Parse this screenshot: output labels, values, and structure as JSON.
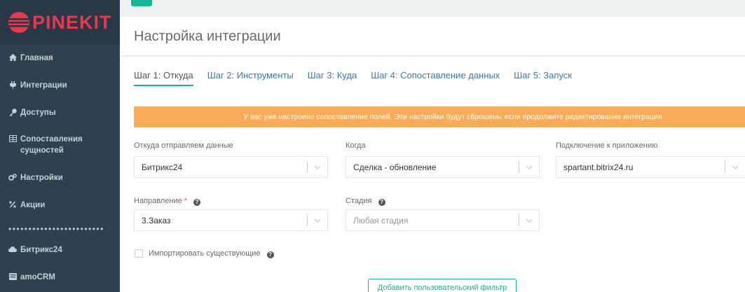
{
  "brand": {
    "name": "PINEKIT",
    "color": "#e8374e"
  },
  "sidebar": {
    "items": [
      {
        "label": "Главная",
        "icon": "home-icon"
      },
      {
        "label": "Интеграции",
        "icon": "plug-icon"
      },
      {
        "label": "Доступы",
        "icon": "key-icon"
      },
      {
        "label": "Сопоставления сущностей",
        "icon": "table-icon"
      },
      {
        "label": "Настройки",
        "icon": "gears-icon"
      },
      {
        "label": "Акции",
        "icon": "percent-icon"
      }
    ],
    "divider": "••••••••••••••••••••••••",
    "services": [
      {
        "label": "Битрикс24",
        "icon": "cloud-icon"
      },
      {
        "label": "amoCRM",
        "icon": "server-icon"
      }
    ]
  },
  "header": {
    "title": "Настройка интеграции"
  },
  "tabs": [
    {
      "label": "Шаг 1: Откуда",
      "active": true
    },
    {
      "label": "Шаг 2: Инструменты",
      "active": false
    },
    {
      "label": "Шаг 3: Куда",
      "active": false
    },
    {
      "label": "Шаг 4: Сопоставление данных",
      "active": false
    },
    {
      "label": "Шаг 5: Запуск",
      "active": false
    }
  ],
  "alert": {
    "text": "У вас уже настроено сопоставление полей. Эти настройки будут сброшены если продолжите редактирование интеграции",
    "color": "#f8ac59"
  },
  "form": {
    "source": {
      "label": "Откуда отправляем данные",
      "value": "Битрикс24"
    },
    "when": {
      "label": "Когда",
      "value": "Сделка - обновление"
    },
    "connection": {
      "label": "Подключение к приложению",
      "value": "spartant.bitrix24.ru"
    },
    "direction": {
      "label": "Направление",
      "required": "*",
      "value": "3.Заказ"
    },
    "stage": {
      "label": "Стадия",
      "placeholder": "Любая стадия"
    },
    "import_existing": {
      "label": "Импортировать существующие",
      "checked": false
    }
  },
  "buttons": {
    "add_filter": "Добавить пользовательский фильтр"
  },
  "accent_color": "#1ab394"
}
